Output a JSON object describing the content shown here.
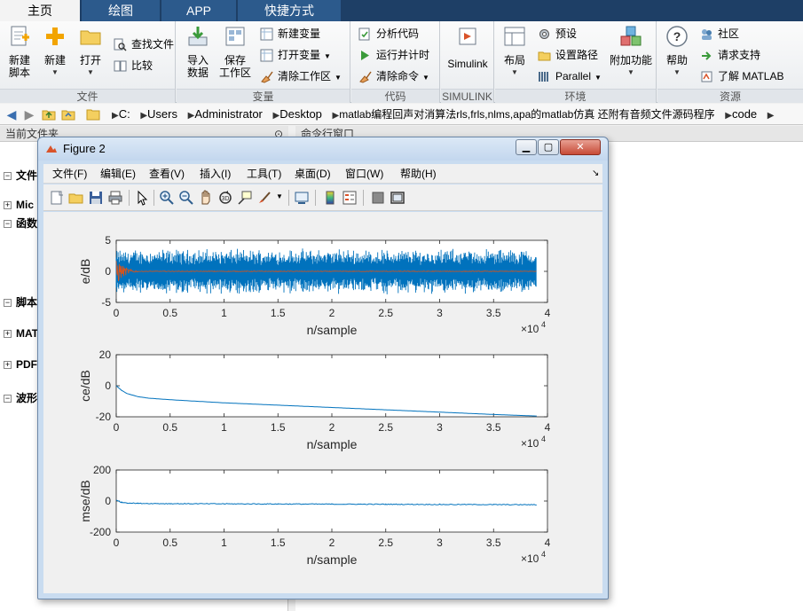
{
  "tabs": [
    {
      "label": "主页",
      "active": true
    },
    {
      "label": "绘图",
      "active": false
    },
    {
      "label": "APP",
      "active": false
    },
    {
      "label": "快捷方式",
      "active": false
    }
  ],
  "ribbon": {
    "file": {
      "title": "文件",
      "new_script": [
        "新建",
        "脚本"
      ],
      "new": "新建",
      "open": "打开",
      "find_files": "查找文件",
      "compare": "比较"
    },
    "variable": {
      "title": "变量",
      "import": [
        "导入",
        "数据"
      ],
      "save_ws": [
        "保存",
        "工作区"
      ],
      "new_var": "新建变量",
      "open_var": "打开变量",
      "clear_ws": "清除工作区"
    },
    "code": {
      "title": "代码",
      "analyze": "分析代码",
      "run_time": "运行并计时",
      "clear_cmd": "清除命令"
    },
    "simulink": {
      "title": "SIMULINK",
      "label": "Simulink"
    },
    "env": {
      "title": "环境",
      "layout": "布局",
      "prefs": "预设",
      "set_path": "设置路径",
      "parallel": "Parallel",
      "addons": "附加功能"
    },
    "resources": {
      "title": "资源",
      "help": "帮助",
      "community": "社区",
      "support": "请求支持",
      "learn": "了解 MATLAB"
    }
  },
  "address": {
    "segments": [
      "C:",
      "Users",
      "Administrator",
      "Desktop",
      "matlab编程回声对消算法rls,frls,nlms,apa的matlab仿真 还附有音频文件源码程序",
      "code"
    ]
  },
  "panels": {
    "current_folder": "当前文件夹",
    "command_window": "命令行窗口",
    "tree": [
      "文件",
      "Mic",
      "函数",
      "脚本",
      "MAT",
      "PDF",
      "波形"
    ]
  },
  "figure": {
    "title": "Figure 2",
    "menus": [
      "文件(F)",
      "编辑(E)",
      "查看(V)",
      "插入(I)",
      "工具(T)",
      "桌面(D)",
      "窗口(W)",
      "帮助(H)"
    ],
    "toolbar_icons": [
      "new-figure-icon",
      "open-file-icon",
      "save-icon",
      "print-icon",
      "pointer-icon",
      "zoom-in-icon",
      "zoom-out-icon",
      "pan-icon",
      "rotate-icon",
      "data-cursor-icon",
      "brush-icon",
      "link-icon",
      "colorbar-icon",
      "legend-icon",
      "hide-tools-icon",
      "dock-icon"
    ],
    "dock_arrow": "↘"
  },
  "colors": {
    "tabbar": "#1e3f66",
    "series_blue": "#0072bd",
    "series_orange": "#d95319"
  },
  "chart_data": [
    {
      "type": "line",
      "ylabel": "e/dB",
      "xlabel": "n/sample",
      "xlim": [
        0,
        40000
      ],
      "ylim": [
        -5,
        5
      ],
      "xticks": [
        "0",
        "0.5",
        "1",
        "1.5",
        "2",
        "2.5",
        "3",
        "3.5",
        "4"
      ],
      "yticks": [
        "5",
        "0",
        "-5"
      ],
      "exponent": "×10",
      "exponent_power": "4",
      "series": [
        {
          "color": "#0072bd",
          "description": "noise-like error signal",
          "amplitude": 3.8,
          "x_end": 39000
        },
        {
          "color": "#d95319",
          "description": "decaying residual echo",
          "initial_amplitude": 2.5,
          "decay_to_x": 2000
        }
      ]
    },
    {
      "type": "line",
      "ylabel": "ce/dB",
      "xlabel": "n/sample",
      "xlim": [
        0,
        40000
      ],
      "ylim": [
        -20,
        20
      ],
      "xticks": [
        "0",
        "0.5",
        "1",
        "1.5",
        "2",
        "2.5",
        "3",
        "3.5",
        "4"
      ],
      "yticks": [
        "20",
        "0",
        "-20"
      ],
      "exponent": "×10",
      "exponent_power": "4",
      "x": [
        0,
        500,
        1000,
        2000,
        3000,
        5000,
        7500,
        10000,
        15000,
        20000,
        25000,
        30000,
        35000,
        39000
      ],
      "y": [
        0,
        -3,
        -5,
        -7,
        -8,
        -9,
        -10,
        -11,
        -12.5,
        -14,
        -15.5,
        -17,
        -18.5,
        -19.5
      ]
    },
    {
      "type": "line",
      "ylabel": "mse/dB",
      "xlabel": "n/sample",
      "xlim": [
        0,
        40000
      ],
      "ylim": [
        -200,
        200
      ],
      "xticks": [
        "0",
        "0.5",
        "1",
        "1.5",
        "2",
        "2.5",
        "3",
        "3.5",
        "4"
      ],
      "yticks": [
        "200",
        "0",
        "-200"
      ],
      "exponent": "×10",
      "exponent_power": "4",
      "x": [
        0,
        500,
        1000,
        2000,
        5000,
        10000,
        15000,
        20000,
        25000,
        30000,
        35000,
        39000
      ],
      "y": [
        5,
        -8,
        -12,
        -15,
        -17,
        -18,
        -19,
        -20,
        -21,
        -22,
        -23,
        -24
      ]
    }
  ]
}
